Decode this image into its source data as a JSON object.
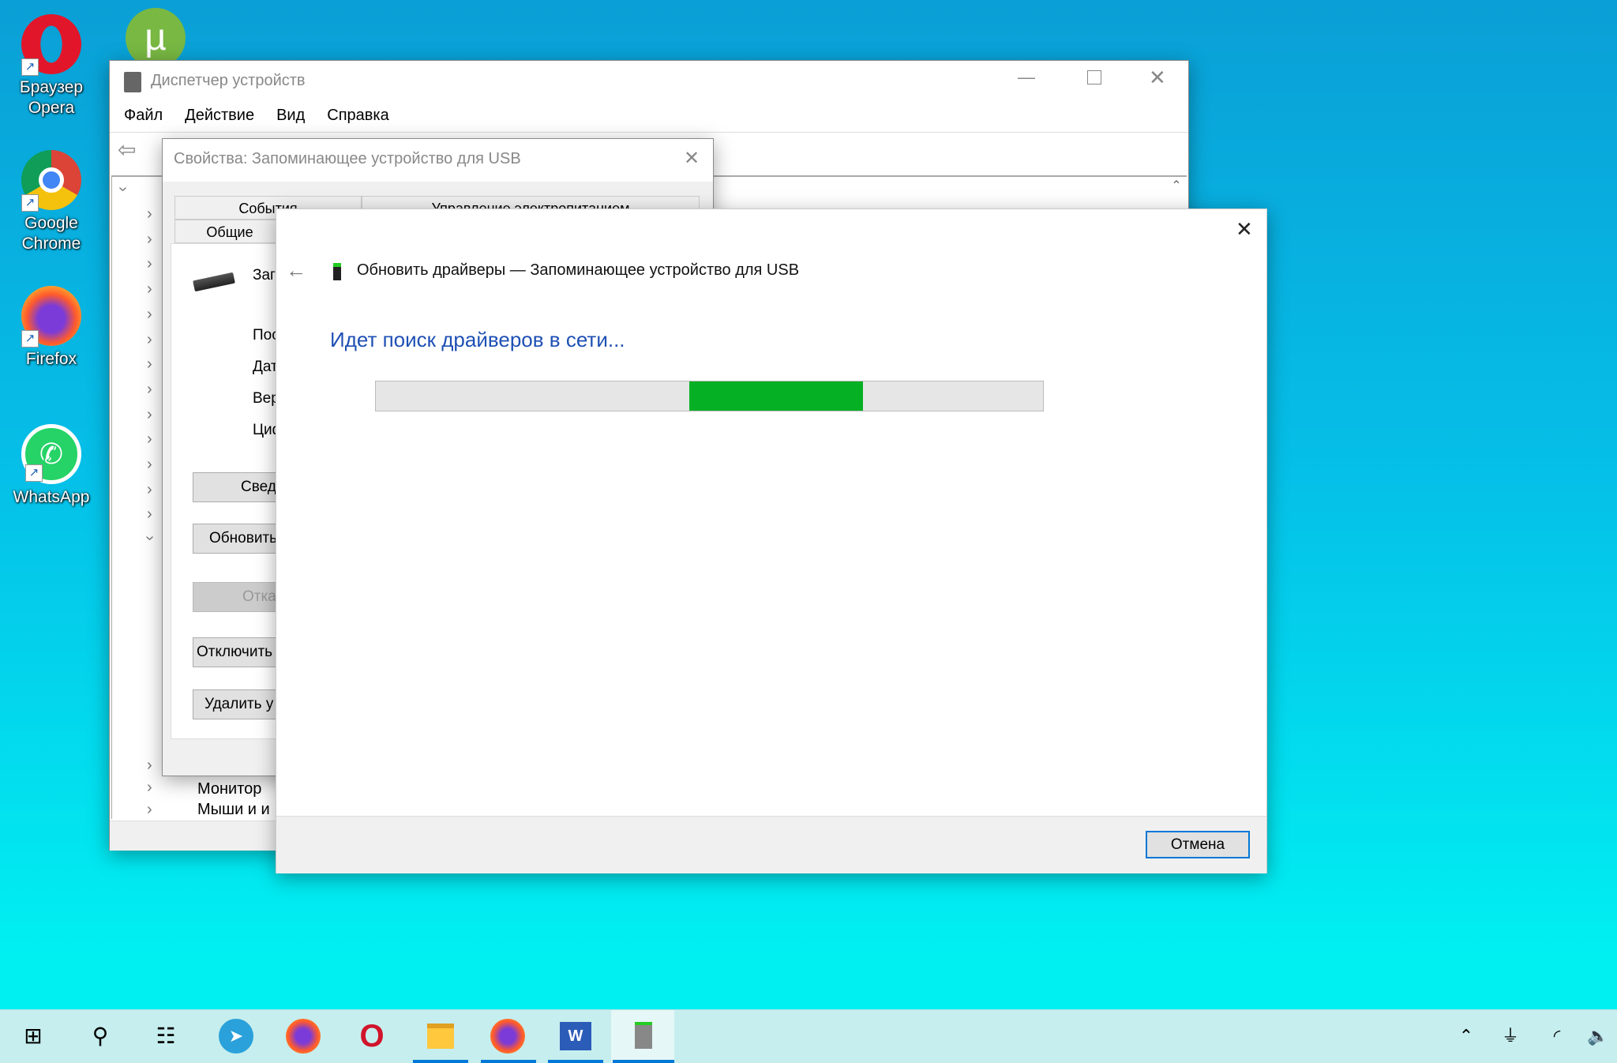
{
  "desktop": {
    "icons": [
      {
        "label_lines": [
          "Браузер",
          "Opera"
        ],
        "icon": "opera-icon"
      },
      {
        "label_lines": [
          "Google",
          "Chrome"
        ],
        "icon": "chrome-icon"
      },
      {
        "label_lines": [
          "Firefox"
        ],
        "icon": "firefox-icon"
      },
      {
        "label_lines": [
          "WhatsApp"
        ],
        "icon": "whatsapp-icon"
      },
      {
        "label_lines": [],
        "icon": "utorrent-icon"
      }
    ]
  },
  "device_manager": {
    "title": "Диспетчер устройств",
    "menu": [
      "Файл",
      "Действие",
      "Вид",
      "Справка"
    ],
    "tree_partial": [
      "Монитор",
      "Мыши и и"
    ]
  },
  "properties_dialog": {
    "title": "Свойства: Запоминающее устройство для USB",
    "tabs": [
      "События",
      "Управление электропитанием",
      "Общие"
    ],
    "labels": [
      "Заг",
      "Пос",
      "Дат",
      "Вер",
      "Циф"
    ],
    "buttons": [
      "Свед",
      "Обновить",
      "Отка",
      "Отключить",
      "Удалить у"
    ]
  },
  "update_dialog": {
    "title": "Обновить драйверы — Запоминающее устройство для USB",
    "status": "Идет поиск драйверов в сети...",
    "progress": {
      "type": "marquee",
      "segment_start": 0.47,
      "segment_length": 0.26,
      "color": "#06b025"
    },
    "cancel_label": "Отмена"
  },
  "taskbar": {
    "icons": [
      "windows-start-icon",
      "search-icon",
      "task-view-icon",
      "telegram-icon",
      "firefox-icon",
      "opera-icon",
      "file-explorer-icon",
      "firefox-icon",
      "word-icon",
      "device-manager-icon"
    ],
    "tray": [
      "chevron-up-icon",
      "power-plug-icon",
      "wifi-icon",
      "volume-icon"
    ]
  },
  "colors": {
    "accent": "#0078d7",
    "heading_blue": "#1e50b4",
    "progress_green": "#06b025"
  }
}
